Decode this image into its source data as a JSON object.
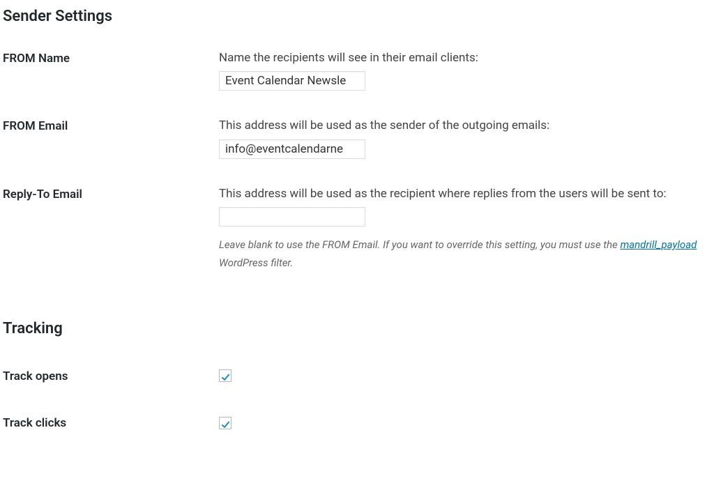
{
  "sections": {
    "sender": {
      "heading": "Sender Settings",
      "fromName": {
        "label": "FROM Name",
        "desc": "Name the recipients will see in their email clients:",
        "value": "Event Calendar Newsle"
      },
      "fromEmail": {
        "label": "FROM Email",
        "desc": "This address will be used as the sender of the outgoing emails:",
        "value": "info@eventcalendarne"
      },
      "replyTo": {
        "label": "Reply-To Email",
        "desc": "This address will be used as the recipient where replies from the users will be sent to:",
        "value": "",
        "help_prefix": "Leave blank to use the FROM Email. If you want to override this setting, you must use the ",
        "help_link": "mandrill_payload",
        "help_suffix": " WordPress filter."
      }
    },
    "tracking": {
      "heading": "Tracking",
      "opens": {
        "label": "Track opens",
        "checked": true
      },
      "clicks": {
        "label": "Track clicks",
        "checked": true
      }
    }
  }
}
